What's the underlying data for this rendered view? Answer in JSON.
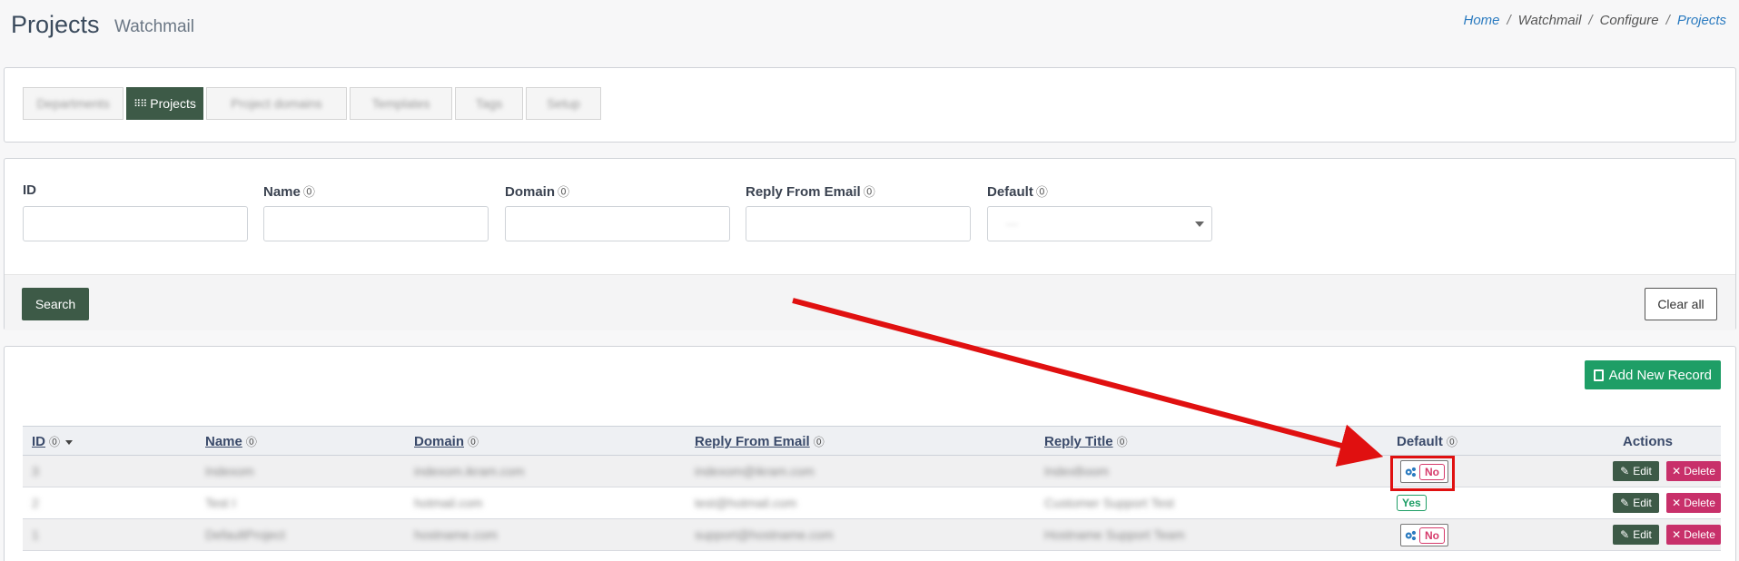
{
  "header": {
    "title": "Projects",
    "subtitle": "Watchmail",
    "breadcrumb": [
      "Home",
      "Watchmail",
      "Configure",
      "Projects"
    ]
  },
  "tabs": [
    {
      "label": "Departments",
      "active": false,
      "blurred": true
    },
    {
      "label": "Projects",
      "active": true,
      "blurred": false
    },
    {
      "label": "Project domains",
      "active": false,
      "blurred": true
    },
    {
      "label": "Templates",
      "active": false,
      "blurred": true
    },
    {
      "label": "Tags",
      "active": false,
      "blurred": true
    },
    {
      "label": "Setup",
      "active": false,
      "blurred": true
    }
  ],
  "filters": {
    "fields": [
      {
        "label": "ID",
        "help": false
      },
      {
        "label": "Name",
        "help": true
      },
      {
        "label": "Domain",
        "help": true
      },
      {
        "label": "Reply From Email",
        "help": true
      },
      {
        "label": "Default",
        "help": true
      }
    ],
    "default_select_value": "---",
    "search_label": "Search",
    "clear_label": "Clear all"
  },
  "results": {
    "add_label": "Add New Record",
    "columns": [
      "ID",
      "Name",
      "Domain",
      "Reply From Email",
      "Reply Title",
      "Default",
      "Actions"
    ],
    "rows": [
      {
        "id": "3",
        "name": "Indexom",
        "domain": "indexom.ikram.com",
        "email": "indexom@ikram.com",
        "title": "IndexBoom",
        "default": "No"
      },
      {
        "id": "2",
        "name": "Test I",
        "domain": "hotmail.com",
        "email": "test@hotmail.com",
        "title": "Customer Support Test",
        "default": "Yes"
      },
      {
        "id": "1",
        "name": "DefaultProject",
        "domain": "hostname.com",
        "email": "support@hostname.com",
        "title": "Hostname Support Team",
        "default": "No"
      }
    ],
    "edit_label": "Edit",
    "delete_label": "Delete"
  },
  "icons": {
    "help": "question-circle-icon",
    "gear": "cogs-icon",
    "edit": "edit-icon",
    "delete": "close-icon",
    "add": "file-plus-icon"
  },
  "colors": {
    "primary_dark_green": "#3d5a47",
    "add_green": "#1e9e66",
    "delete_pink": "#c8306a",
    "annotation_red": "#e01010",
    "link_blue": "#2b7bc0"
  }
}
